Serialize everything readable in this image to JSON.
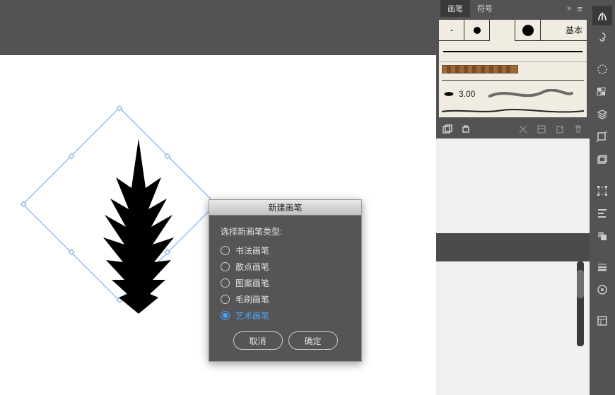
{
  "panel": {
    "tabs": {
      "brushes": "画笔",
      "symbols": "符号"
    },
    "basic_label": "基本",
    "stroke_value": "3.00"
  },
  "dialog": {
    "title": "新建画笔",
    "prompt": "选择新画笔类型:",
    "options": {
      "calligraphy": "书法画笔",
      "scatter": "散点画笔",
      "pattern": "图案画笔",
      "bristle": "毛刷画笔",
      "art": "艺术画笔"
    },
    "cancel": "取消",
    "ok": "确定"
  }
}
